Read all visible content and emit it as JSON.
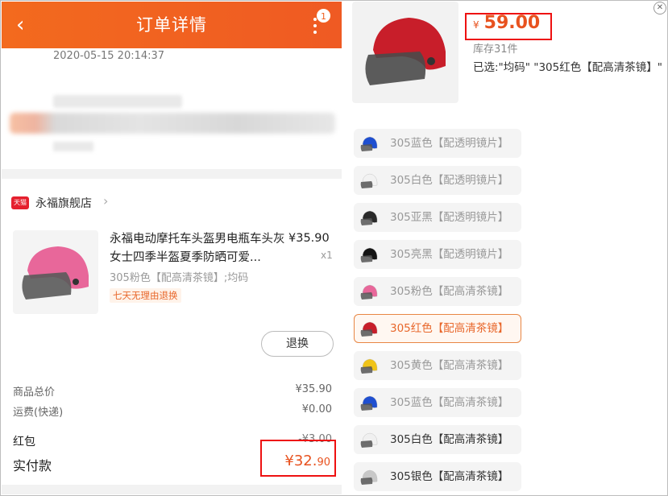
{
  "order": {
    "title": "订单详情",
    "badge_count": "1",
    "date": "2020-05-15 20:14:37",
    "shop_tag": "天猫",
    "shop_name": "永福旗舰店",
    "product": {
      "title": "永福电动摩托车头盔男电瓶车头灰女士四季半盔夏季防晒可爱...",
      "price": "¥35.90",
      "qty": "x1",
      "spec": "305粉色【配高清茶镜】;均码",
      "tag": "七天无理由退换",
      "color": "#e8679a"
    },
    "refund_button": "退换",
    "summary": {
      "goods_label": "商品总价",
      "goods_value": "¥35.90",
      "shipping_label": "运费(快递)",
      "shipping_value": "¥0.00",
      "redpacket_label": "红包",
      "redpacket_value": "-¥3.00",
      "paid_label": "实付款",
      "paid_main": "¥32.",
      "paid_cents": "90"
    }
  },
  "sku": {
    "price_symbol": "¥",
    "price": "59.00",
    "stock": "库存31件",
    "selected": "已选:\"均码\" \"305红色【配高清茶镜】\"",
    "main_color": "#c81e2a",
    "options": [
      {
        "label": "305蓝色【配透明镜片】",
        "color": "#1f4fd0",
        "state": "normal"
      },
      {
        "label": "305白色【配透明镜片】",
        "color": "#f2f2f2",
        "state": "normal"
      },
      {
        "label": "305亚黑【配透明镜片】",
        "color": "#2a2a2a",
        "state": "normal"
      },
      {
        "label": "305亮黑【配透明镜片】",
        "color": "#151515",
        "state": "normal"
      },
      {
        "label": "305粉色【配高清茶镜】",
        "color": "#e8679a",
        "state": "normal"
      },
      {
        "label": "305红色【配高清茶镜】",
        "color": "#c81e2a",
        "state": "selected"
      },
      {
        "label": "305黄色【配高清茶镜】",
        "color": "#f0c419",
        "state": "normal"
      },
      {
        "label": "305蓝色【配高清茶镜】",
        "color": "#1f4fd0",
        "state": "normal"
      },
      {
        "label": "305白色【配高清茶镜】",
        "color": "#f0f0f0",
        "state": "dark"
      },
      {
        "label": "305银色【配高清茶镜】",
        "color": "#c8c8c8",
        "state": "dark"
      }
    ]
  }
}
